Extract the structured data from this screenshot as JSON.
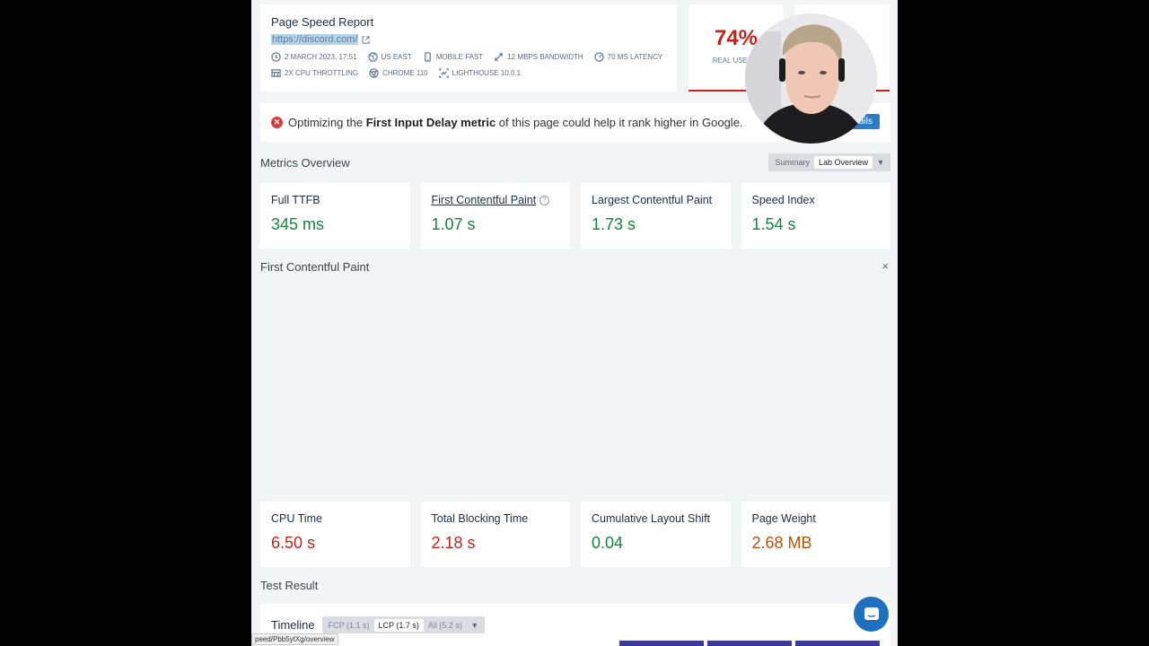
{
  "report": {
    "title": "Page Speed Report",
    "url": "https://discord.com/",
    "meta": [
      {
        "icon": "clock-icon",
        "label": "2 March 2023, 17:51"
      },
      {
        "icon": "globe-icon",
        "label": "US East"
      },
      {
        "icon": "mobile-icon",
        "label": "Mobile Fast"
      },
      {
        "icon": "bandwidth-icon",
        "label": "12 Mbps Bandwidth"
      },
      {
        "icon": "latency-icon",
        "label": "70 ms Latency"
      }
    ],
    "meta2": [
      {
        "icon": "cpu-icon",
        "label": "2x CPU Throttling"
      },
      {
        "icon": "chrome-icon",
        "label": "Chrome 110"
      },
      {
        "icon": "lighthouse-icon",
        "label": "Lighthouse 10.0.1"
      }
    ]
  },
  "score": {
    "value": "74%",
    "label": "Real User S"
  },
  "alert": {
    "prefix": "Optimizing the ",
    "bold": "First Input Delay metric",
    "suffix": " of this page could help it rank higher in Google.",
    "button": "ails"
  },
  "metrics_overview": {
    "title": "Metrics Overview",
    "toggle": {
      "summary": "Summary",
      "lab": "Lab Overview"
    }
  },
  "metrics_top": [
    {
      "name": "Full TTFB",
      "value": "345 ms",
      "status": "green"
    },
    {
      "name": "First Contentful Paint",
      "value": "1.07 s",
      "status": "green"
    },
    {
      "name": "Largest Contentful Paint",
      "value": "1.73 s",
      "status": "green"
    },
    {
      "name": "Speed Index",
      "value": "1.54 s",
      "status": "green"
    }
  ],
  "fcp_panel": {
    "title": "First Contentful Paint",
    "close": "×"
  },
  "metrics_bottom": [
    {
      "name": "CPU Time",
      "value": "6.50 s",
      "status": "red"
    },
    {
      "name": "Total Blocking Time",
      "value": "2.18 s",
      "status": "red"
    },
    {
      "name": "Cumulative Layout Shift",
      "value": "0.04",
      "status": "green"
    },
    {
      "name": "Page Weight",
      "value": "2.68 MB",
      "status": "orange"
    }
  ],
  "test_result": {
    "title": "Test Result"
  },
  "timeline": {
    "title": "Timeline",
    "options": [
      {
        "label": "FCP (1.1 s)",
        "active": false
      },
      {
        "label": "LCP (1.7 s)",
        "active": true
      },
      {
        "label": "All (5.2 s)",
        "active": false
      }
    ]
  },
  "status_bar_url": "peed/Pbb5ytXg/overview",
  "colors": {
    "good": "#17843e",
    "bad": "#c0241b",
    "warn": "#b8530c",
    "accent": "#2a7cc7"
  }
}
